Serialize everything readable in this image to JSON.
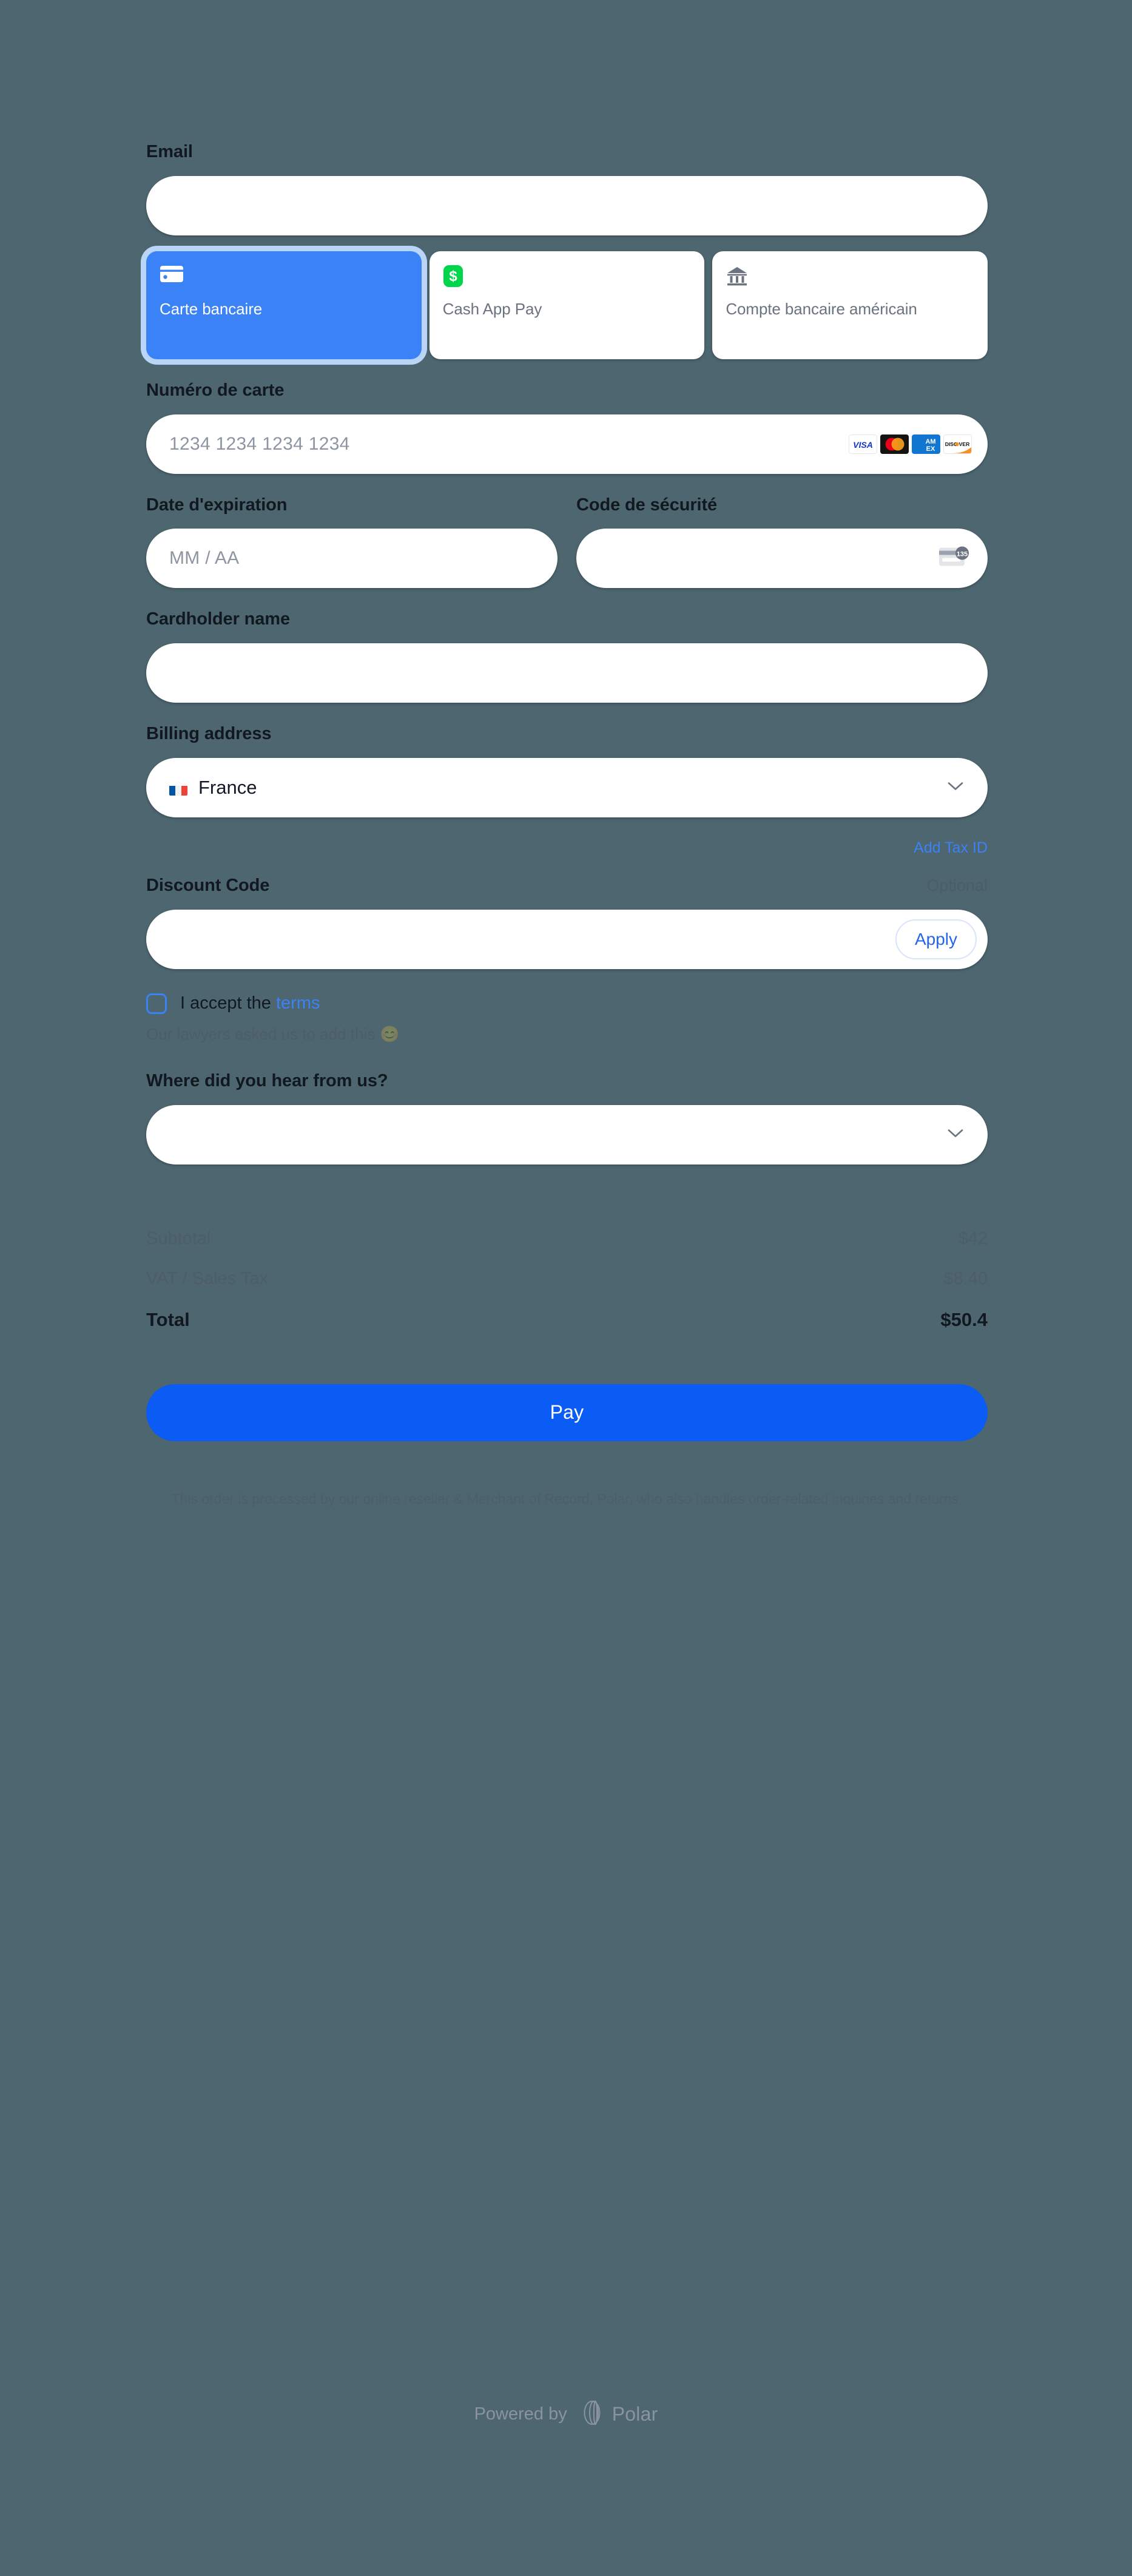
{
  "theme": {
    "background": "#4d6670",
    "accent": "#3b82f6",
    "pay_button": "#0b5cf5",
    "link": "#3b82f6",
    "muted_text": "rgba(80,70,86,0.27)"
  },
  "email": {
    "label": "Email",
    "value": "",
    "placeholder": ""
  },
  "payment_methods": {
    "selected_index": 0,
    "tabs": [
      {
        "label": "Carte bancaire",
        "icon": "credit-card-icon",
        "selected": true
      },
      {
        "label": "Cash App Pay",
        "icon": "cash-app-icon",
        "selected": false
      },
      {
        "label": "Compte bancaire américain",
        "icon": "bank-icon",
        "selected": false
      }
    ]
  },
  "card_number": {
    "label": "Numéro de carte",
    "placeholder": "1234 1234 1234 1234",
    "value": "",
    "brands": [
      "VISA",
      "Mastercard",
      "AMEX",
      "DISCOVER"
    ],
    "brand_labels": {
      "visa": "VISA",
      "amex_top": "AM",
      "amex_bottom": "EX",
      "discover": "DISC VER"
    }
  },
  "expiry": {
    "label": "Date d'expiration",
    "placeholder": "MM / AA",
    "value": ""
  },
  "cvc": {
    "label": "Code de sécurité",
    "placeholder": "",
    "value": "",
    "icon_badge": "135"
  },
  "cardholder": {
    "label": "Cardholder name",
    "value": "",
    "placeholder": ""
  },
  "billing": {
    "label": "Billing address",
    "country": "France",
    "flag": "flag-france",
    "add_tax_id": "Add Tax ID"
  },
  "discount": {
    "label": "Discount Code",
    "optional": "Optional",
    "value": "",
    "placeholder": "",
    "apply_label": "Apply"
  },
  "terms": {
    "prefix": "I accept the ",
    "link": "terms",
    "checked": false,
    "subtext": "Our lawyers asked us to add this ",
    "emoji": "😊"
  },
  "hear_from": {
    "label": "Where did you hear from us?",
    "value": "",
    "placeholder": ""
  },
  "summary": {
    "rows": [
      {
        "label": "Subtotal",
        "value": "$42"
      },
      {
        "label": "VAT / Sales Tax",
        "value": "$8.40"
      }
    ],
    "total_label": "Total",
    "total_value": "$50.4"
  },
  "pay": {
    "label": "Pay"
  },
  "disclaimer": {
    "text": "This order is processed by our online reseller & Merchant of Record, Polar, who also handles order-related inquiries and returns."
  },
  "footer": {
    "powered_by": "Powered by",
    "brand": "Polar"
  }
}
